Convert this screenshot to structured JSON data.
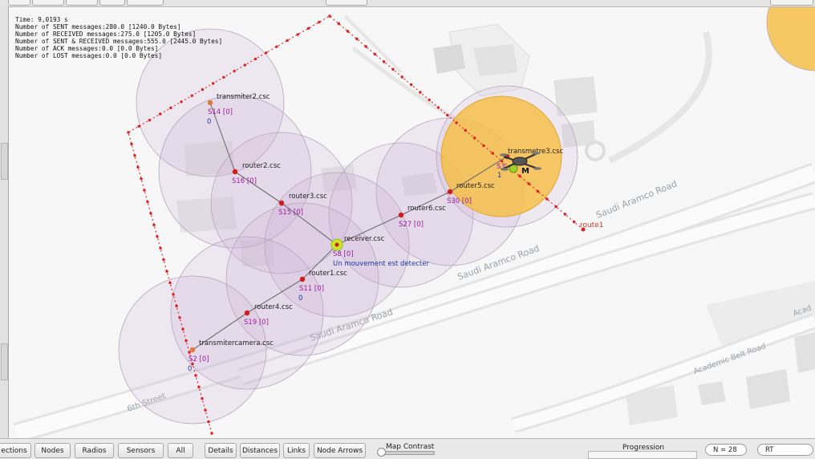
{
  "stats": [
    "Time: 9,0193 s",
    "Number of SENT messages:280.0 [1240.0  Bytes]",
    "Number of RECEIVED messages:275.0 [1205.0  Bytes]",
    "Number of SENT & RECEIVED messages:555.0 [2445.0  Bytes]",
    "Number of ACK messages:0.0 [0.0  Bytes]",
    "Number of LOST messages:0.0 [0.0  Bytes]"
  ],
  "roads": {
    "aramco_1": "Saudi Aramco Road",
    "aramco_2": "Saudi Aramco Road",
    "aramco_3": "Saudi Aramco Road",
    "academic": "Academic Belt Road",
    "acad_partial": "Acad",
    "street": "6th Street"
  },
  "nodes": {
    "transmitter2": {
      "name": "transmiter2.csc",
      "id": "S14 [0]",
      "counter": "0"
    },
    "router2": {
      "name": "router2.csc",
      "id": "S16 [0]"
    },
    "router3": {
      "name": "router3.csc",
      "id": "S15 [0]"
    },
    "router6": {
      "name": "router6.csc",
      "id": "S27 [0]"
    },
    "router5": {
      "name": "router5.csc",
      "id": "S30 [0]"
    },
    "transmitter3": {
      "name": "transmetre3.csc",
      "id": "S3",
      "counter": "1"
    },
    "receiver": {
      "name": "receiver.csc",
      "id": "S8 [0]",
      "message": "Un mouvement est detecter"
    },
    "router1": {
      "name": "router1.csc",
      "id": "S11 [0]",
      "counter": "0"
    },
    "router4": {
      "name": "router4.csc",
      "id": "S19 [0]"
    },
    "camera": {
      "name": "transmitercamera.csc",
      "id": "S2 [0]",
      "counter": "0"
    }
  },
  "drone": {
    "label": "M"
  },
  "route": {
    "name": "route1"
  },
  "toolbar": {
    "sections": "ections",
    "nodes": "Nodes",
    "radios": "Radios",
    "sensors": "Sensors",
    "all": "All",
    "details": "Details",
    "distances": "Distances",
    "links": "Links",
    "node_arrows": "Node Arrows",
    "map_contrast": "Map Contrast",
    "progression": "Progression",
    "n_nodes": "N = 28",
    "rt": "RT"
  },
  "colors": {
    "radio_fill": "#c9a8d4",
    "radio_stroke": "#b7a6bd",
    "active_radio": "#f6c04a",
    "route_red": "#e02020",
    "node_red": "#d11b1b",
    "node_id_purple": "#9b1b9e",
    "counter_blue": "#1c3aa0",
    "link_gray": "#6e6e6e",
    "receiver_green": "#c6e82a"
  },
  "icons": [
    "drone-icon",
    "sensor-node-icon",
    "receiver-node-icon"
  ]
}
